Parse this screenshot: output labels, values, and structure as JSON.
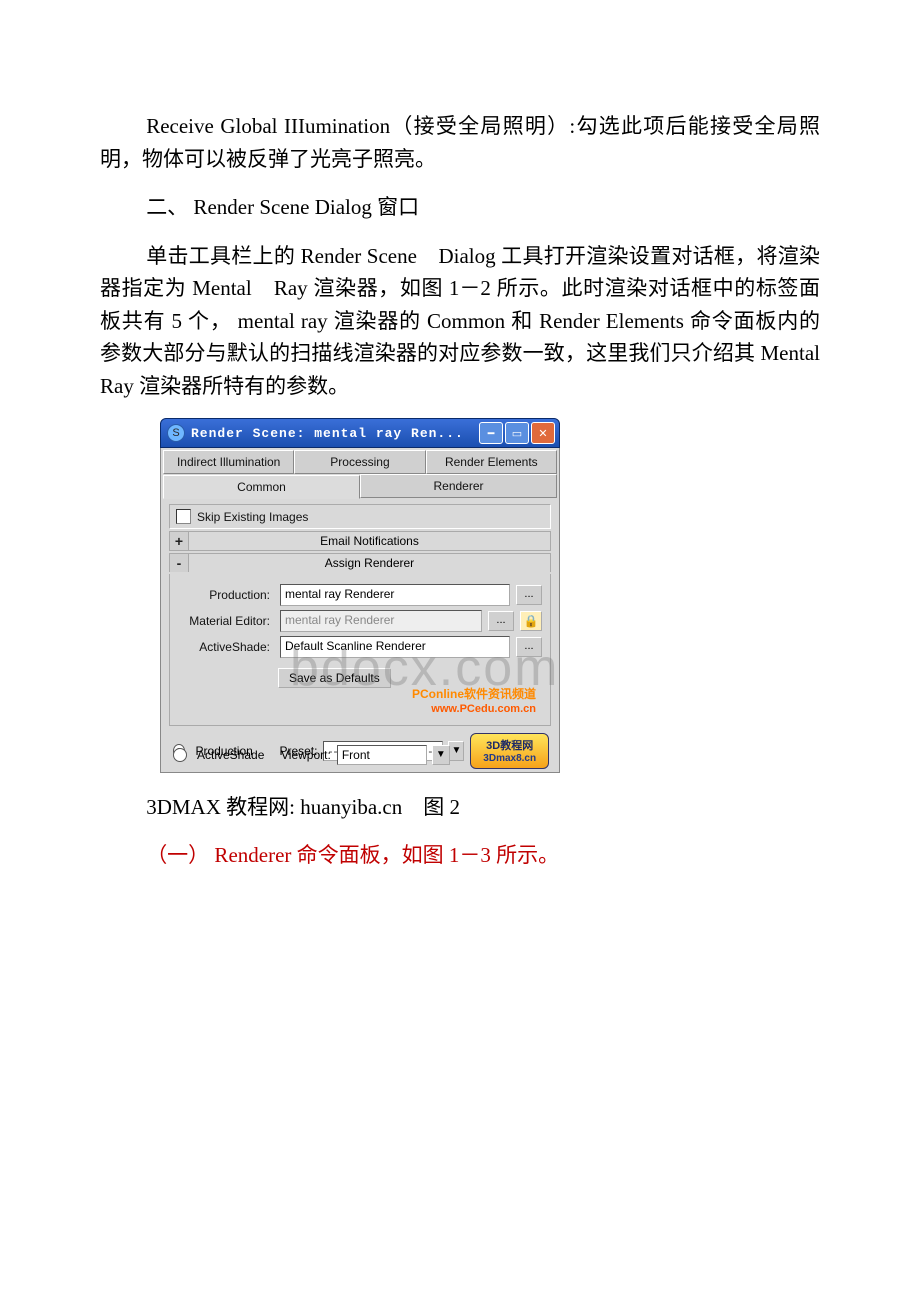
{
  "paragraphs": {
    "p1": "Receive Global IIIumination（接受全局照明）:勾选此项后能接受全局照明，物体可以被反弹了光亮子照亮。",
    "p2": "二、 Render Scene Dialog 窗口",
    "p3": "单击工具栏上的 Render Scene　Dialog 工具打开渲染设置对话框，将渲染器指定为 Mental　Ray 渲染器，如图 1－2 所示。此时渲染对话框中的标签面板共有 5 个， mental ray 渲染器的 Common 和 Render Elements 命令面板内的参数大部分与默认的扫描线渲染器的对应参数一致，这里我们只介绍其 Mental　Ray 渲染器所特有的参数。",
    "caption": "3DMAX 教程网: huanyiba.cn　图 2",
    "p4": "（一） Renderer 命令面板，如图 1－3 所示。"
  },
  "watermark": "bdocx.com",
  "dialog": {
    "title": "Render Scene: mental ray Ren...",
    "tabs_row1": [
      "Indirect Illumination",
      "Processing",
      "Render Elements"
    ],
    "tabs_row2": [
      "Common",
      "Renderer"
    ],
    "skip_label": "Skip Existing Images",
    "rollups": {
      "email": "Email Notifications",
      "assign": "Assign Renderer"
    },
    "assign": {
      "production_label": "Production:",
      "production_value": "mental ray Renderer",
      "material_label": "Material Editor:",
      "material_value": "mental ray Renderer",
      "activeshade_label": "ActiveShade:",
      "activeshade_value": "Default Scanline Renderer",
      "save_defaults": "Save as Defaults"
    },
    "dots": "...",
    "pconline1": "PConline软件资讯频道",
    "pconline2": "www.PCedu.com.cn",
    "footer": {
      "production": "Production",
      "activeshade": "ActiveShade",
      "preset_label": "Preset:",
      "preset_value": "----------------------",
      "viewport_label": "Viewport:",
      "viewport_value": "Front",
      "badge_line1": "3D教程网",
      "badge_line2": "3Dmax8.cn"
    }
  }
}
